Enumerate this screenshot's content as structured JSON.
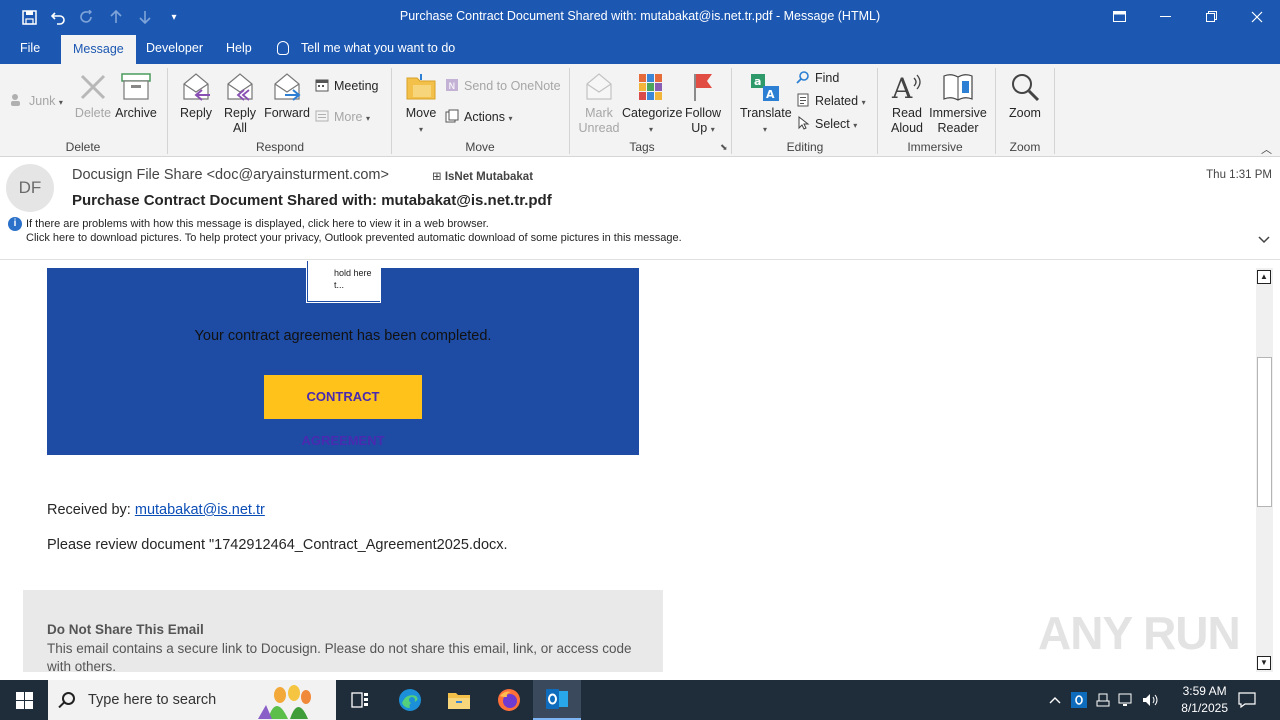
{
  "window": {
    "title": "Purchase Contract Document Shared with: mutabakat@is.net.tr.pdf  -  Message (HTML)"
  },
  "menu_tabs": [
    {
      "label": "File"
    },
    {
      "label": "Message"
    },
    {
      "label": "Developer"
    },
    {
      "label": "Help"
    }
  ],
  "tell_me": "Tell me what you want to do",
  "ribbon": {
    "delete_group": {
      "label": "Delete",
      "junk": "Junk",
      "delete": "Delete",
      "archive": "Archive"
    },
    "respond_group": {
      "label": "Respond",
      "reply": "Reply",
      "reply_all_1": "Reply",
      "reply_all_2": "All",
      "forward": "Forward",
      "meeting": "Meeting",
      "more": "More"
    },
    "move_group": {
      "label": "Move",
      "move": "Move",
      "onenote": "Send to OneNote",
      "actions": "Actions"
    },
    "tags_group": {
      "label": "Tags",
      "mark_unread_1": "Mark",
      "mark_unread_2": "Unread",
      "categorize": "Categorize",
      "follow_up_1": "Follow",
      "follow_up_2": "Up"
    },
    "editing_group": {
      "label": "Editing",
      "translate": "Translate",
      "find": "Find",
      "related": "Related",
      "select": "Select"
    },
    "immersive_group": {
      "label": "Immersive",
      "read_aloud_1": "Read",
      "read_aloud_2": "Aloud",
      "immersive_reader_1": "Immersive",
      "immersive_reader_2": "Reader"
    },
    "zoom_group": {
      "label": "Zoom",
      "zoom": "Zoom"
    }
  },
  "message": {
    "avatar_initials": "DF",
    "from": "Docusign File Share <doc@aryainsturment.com>",
    "to": "IsNet Mutabakat",
    "date": "Thu 1:31 PM",
    "subject": "Purchase Contract Document Shared with: mutabakat@is.net.tr.pdf",
    "info_line_1": "If there are problems with how this message is displayed, click here to view it in a web browser.",
    "info_line_2": "Click here to download pictures. To help protect your privacy, Outlook prevented automatic download of some pictures in this message."
  },
  "body": {
    "image_placeholder": "hold here t...",
    "completed_text": "Your contract agreement has been completed.",
    "cta_label": "CONTRACT AGREEMENT",
    "received_prefix": "Received by: ",
    "received_email": "mutabakat@is.net.tr",
    "review_text": "Please review document \"1742912464_Contract_Agreement2025.docx.",
    "notice_heading": "Do Not Share This Email",
    "notice_text": "This email contains a secure link to Docusign. Please do not share this email, link, or access code with others."
  },
  "watermark": "ANY RUN",
  "taskbar": {
    "search_placeholder": "Type here to search",
    "time": "3:59 AM",
    "date": "8/1/2025"
  },
  "colors": {
    "titlebar": "#1c58b2",
    "banner": "#1e4ca4",
    "cta": "#ffc21a",
    "taskbar": "#1f2c3a"
  }
}
